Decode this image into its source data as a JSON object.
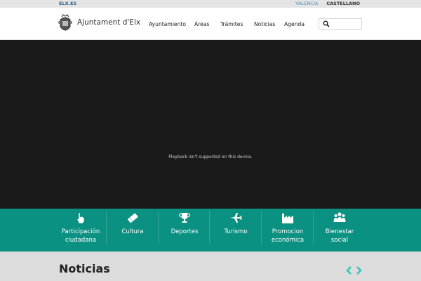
{
  "topbar": {
    "site": "ELX.ES",
    "lang_valencia": "VALENCIÀ",
    "lang_castellano": "CASTELLANO"
  },
  "header": {
    "brand": "Ajuntament d'Elx",
    "nav": [
      "Ayuntamiento",
      "Áreas",
      "Trámites",
      "Noticias",
      "Agenda"
    ],
    "search_placeholder": ""
  },
  "video": {
    "message": "Playback isn't supported on this device."
  },
  "categories": [
    {
      "label_1": "Participación",
      "label_2": "ciudadana",
      "icon": "hand-pointer-icon"
    },
    {
      "label_1": "Cultura",
      "label_2": "",
      "icon": "ticket-icon"
    },
    {
      "label_1": "Deportes",
      "label_2": "",
      "icon": "trophy-icon"
    },
    {
      "label_1": "Turismo",
      "label_2": "",
      "icon": "plane-icon"
    },
    {
      "label_1": "Promocion",
      "label_2": "económica",
      "icon": "factory-icon"
    },
    {
      "label_1": "Bienestar",
      "label_2": "social",
      "icon": "people-icon"
    }
  ],
  "news": {
    "title": "Noticias"
  },
  "colors": {
    "teal": "#0b9181",
    "arrow": "#2ec4b6"
  }
}
